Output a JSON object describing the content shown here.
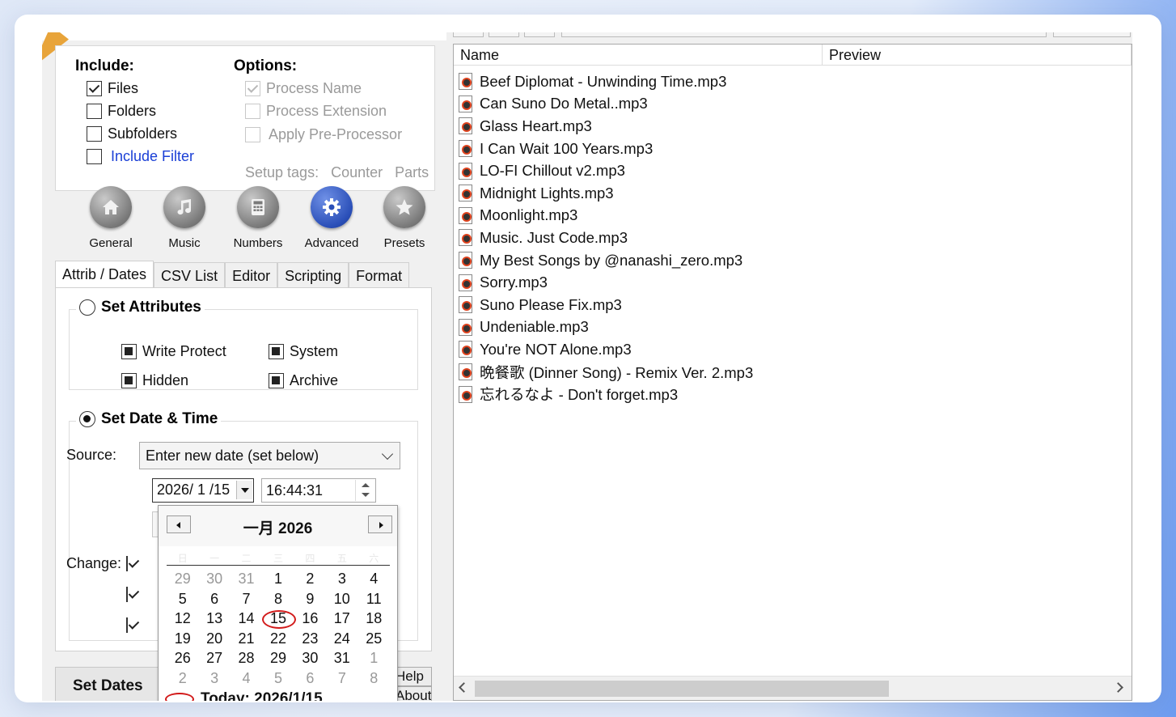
{
  "include": {
    "title": "Include:",
    "files": {
      "label": "Files",
      "checked": true
    },
    "folders": {
      "label": "Folders",
      "checked": false
    },
    "subfolders": {
      "label": "Subfolders",
      "checked": false
    },
    "filter": {
      "label": "Include Filter",
      "checked": false
    }
  },
  "options": {
    "title": "Options:",
    "process_name": {
      "label": "Process Name",
      "checked": true
    },
    "process_extension": {
      "label": "Process Extension",
      "checked": false
    },
    "apply_preprocessor": {
      "label": "Apply Pre-Processor",
      "checked": false
    },
    "setup_tags_label": "Setup tags:",
    "setup_counter": "Counter",
    "setup_parts": "Parts"
  },
  "modes": [
    {
      "label": "General",
      "icon": "house-icon"
    },
    {
      "label": "Music",
      "icon": "music-note-icon"
    },
    {
      "label": "Numbers",
      "icon": "calculator-icon"
    },
    {
      "label": "Advanced",
      "icon": "gear-icon"
    },
    {
      "label": "Presets",
      "icon": "star-icon"
    }
  ],
  "tabs": [
    "Attrib / Dates",
    "CSV List",
    "Editor",
    "Scripting",
    "Format"
  ],
  "active_tab": "Attrib / Dates",
  "attributes": {
    "legend": "Set Attributes",
    "write_protect": "Write Protect",
    "system": "System",
    "hidden": "Hidden",
    "archive": "Archive"
  },
  "datetime": {
    "legend": "Set Date & Time",
    "source_label": "Source:",
    "source_value": "Enter new date (set below)",
    "date_value": "2026/ 1 /15",
    "time_value": "16:44:31",
    "change_label": "Change:"
  },
  "calendar": {
    "month_title": "一月 2026",
    "dow": [
      "日",
      "一",
      "二",
      "三",
      "四",
      "五",
      "六"
    ],
    "weeks": [
      [
        {
          "d": "29",
          "o": true
        },
        {
          "d": "30",
          "o": true
        },
        {
          "d": "31",
          "o": true
        },
        {
          "d": "1"
        },
        {
          "d": "2"
        },
        {
          "d": "3"
        },
        {
          "d": "4"
        }
      ],
      [
        {
          "d": "5"
        },
        {
          "d": "6"
        },
        {
          "d": "7"
        },
        {
          "d": "8"
        },
        {
          "d": "9"
        },
        {
          "d": "10"
        },
        {
          "d": "11"
        }
      ],
      [
        {
          "d": "12"
        },
        {
          "d": "13"
        },
        {
          "d": "14"
        },
        {
          "d": "15",
          "t": true
        },
        {
          "d": "16"
        },
        {
          "d": "17"
        },
        {
          "d": "18"
        }
      ],
      [
        {
          "d": "19"
        },
        {
          "d": "20"
        },
        {
          "d": "21"
        },
        {
          "d": "22"
        },
        {
          "d": "23"
        },
        {
          "d": "24"
        },
        {
          "d": "25"
        }
      ],
      [
        {
          "d": "26"
        },
        {
          "d": "27"
        },
        {
          "d": "28"
        },
        {
          "d": "29"
        },
        {
          "d": "30"
        },
        {
          "d": "31"
        },
        {
          "d": "1",
          "o": true
        }
      ],
      [
        {
          "d": "2",
          "o": true
        },
        {
          "d": "3",
          "o": true
        },
        {
          "d": "4",
          "o": true
        },
        {
          "d": "5",
          "o": true
        },
        {
          "d": "6",
          "o": true
        },
        {
          "d": "7",
          "o": true
        },
        {
          "d": "8",
          "o": true
        }
      ]
    ],
    "today_label": "Today: 2026/1/15"
  },
  "bottom": {
    "set_dates": "Set Dates",
    "help": "Help",
    "about": "About"
  },
  "file_list": {
    "columns": [
      "Name",
      "Preview"
    ],
    "files": [
      "Beef Diplomat - Unwinding Time.mp3",
      "Can Suno Do Metal..mp3",
      "Glass Heart.mp3",
      "I Can Wait 100 Years.mp3",
      "LO-FI Chillout v2.mp3",
      "Midnight Lights.mp3",
      "Moonlight.mp3",
      "Music. Just Code.mp3",
      "My Best Songs by @nanashi_zero.mp3",
      "Sorry.mp3",
      "Suno Please Fix.mp3",
      "Undeniable.mp3",
      "You're NOT Alone.mp3",
      "晩餐歌 (Dinner Song) - Remix Ver. 2.mp3",
      "忘れるなよ - Don't forget.mp3"
    ]
  },
  "colors": {
    "link": "#1a3fd6",
    "today_circle": "#d21a1a",
    "advanced_icon": "#2a4fb8"
  }
}
